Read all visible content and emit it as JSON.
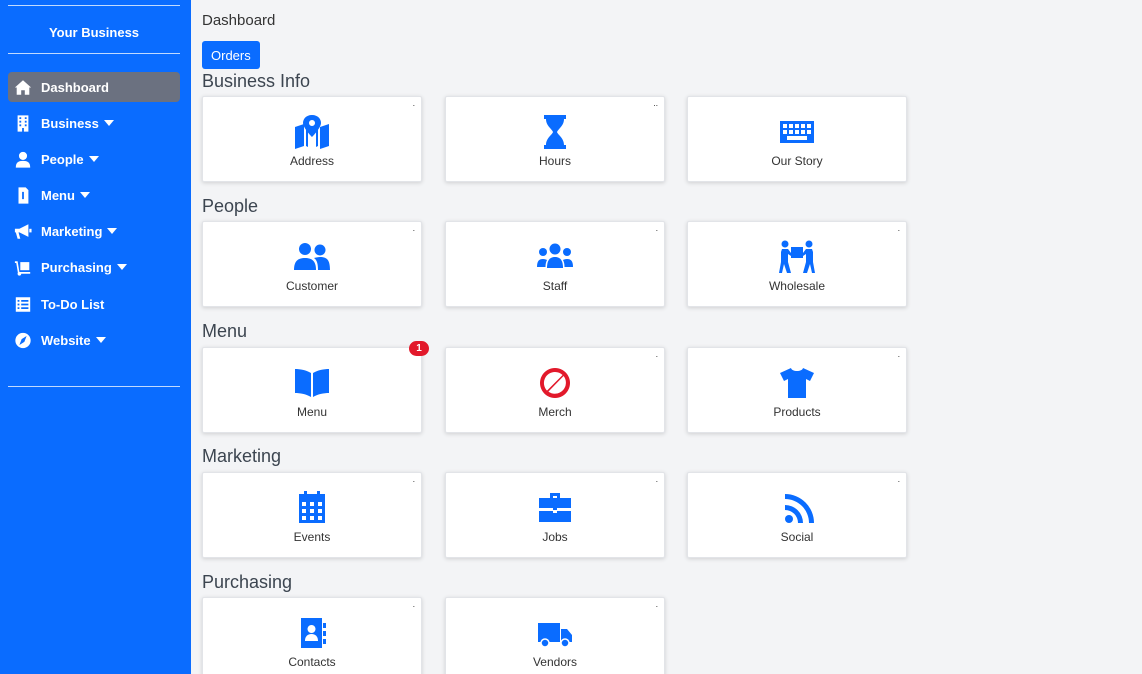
{
  "sidebar": {
    "brand": "Your Business",
    "items": [
      {
        "label": "Dashboard",
        "icon": "home-icon",
        "active": true,
        "dropdown": false
      },
      {
        "label": "Business",
        "icon": "building-icon",
        "active": false,
        "dropdown": true
      },
      {
        "label": "People",
        "icon": "user-icon",
        "active": false,
        "dropdown": true
      },
      {
        "label": "Menu",
        "icon": "receipt-icon",
        "active": false,
        "dropdown": true
      },
      {
        "label": "Marketing",
        "icon": "megaphone-icon",
        "active": false,
        "dropdown": true
      },
      {
        "label": "Purchasing",
        "icon": "dolly-icon",
        "active": false,
        "dropdown": true
      },
      {
        "label": "To-Do List",
        "icon": "list-icon",
        "active": false,
        "dropdown": false
      },
      {
        "label": "Website",
        "icon": "compass-icon",
        "active": false,
        "dropdown": true
      }
    ]
  },
  "header": {
    "breadcrumb": "Dashboard",
    "orders_label": "Orders"
  },
  "sections": [
    {
      "title": "Business Info",
      "cards": [
        {
          "label": "Address",
          "icon": "map-marker-icon",
          "corner": "."
        },
        {
          "label": "Hours",
          "icon": "hourglass-icon",
          "corner": ".."
        },
        {
          "label": "Our Story",
          "icon": "keyboard-icon",
          "corner": ""
        }
      ]
    },
    {
      "title": "People",
      "cards": [
        {
          "label": "Customer",
          "icon": "users-icon",
          "corner": "."
        },
        {
          "label": "Staff",
          "icon": "user-group-icon",
          "corner": "."
        },
        {
          "label": "Wholesale",
          "icon": "people-carry-icon",
          "corner": "."
        }
      ]
    },
    {
      "title": "Menu",
      "cards": [
        {
          "label": "Menu",
          "icon": "book-open-icon",
          "corner": "",
          "badge": "1"
        },
        {
          "label": "Merch",
          "icon": "ban-icon",
          "corner": "."
        },
        {
          "label": "Products",
          "icon": "tshirt-icon",
          "corner": "."
        }
      ]
    },
    {
      "title": "Marketing",
      "cards": [
        {
          "label": "Events",
          "icon": "calendar-icon",
          "corner": "."
        },
        {
          "label": "Jobs",
          "icon": "briefcase-icon",
          "corner": "."
        },
        {
          "label": "Social",
          "icon": "rss-icon",
          "corner": "."
        }
      ]
    },
    {
      "title": "Purchasing",
      "cards": [
        {
          "label": "Contacts",
          "icon": "address-book-icon",
          "corner": "."
        },
        {
          "label": "Vendors",
          "icon": "truck-icon",
          "corner": "."
        }
      ]
    }
  ],
  "colors": {
    "accent": "#0a6cff",
    "sidebar_active": "#6b7180",
    "badge": "#e2192b",
    "merch_icon": "#e2192b"
  }
}
